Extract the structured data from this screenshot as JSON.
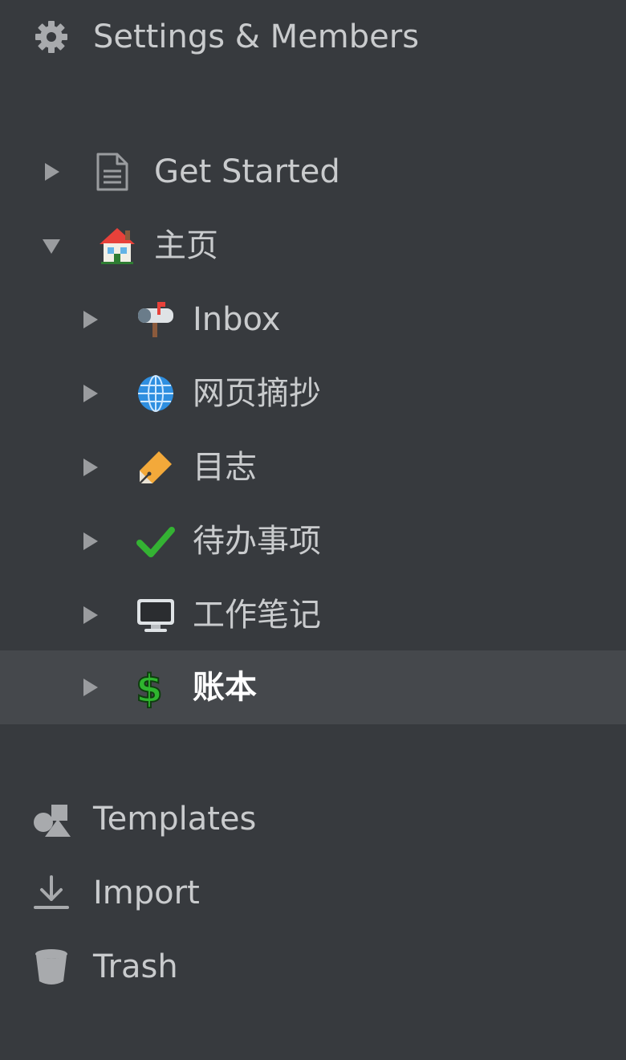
{
  "sidebar": {
    "top": {
      "settings": {
        "label": "Settings & Members",
        "icon": "gear-icon"
      }
    },
    "tree": [
      {
        "label": "Get Started",
        "icon": "document-icon",
        "expanded": false,
        "level": 0
      },
      {
        "label": "主页",
        "icon": "house-icon",
        "expanded": true,
        "level": 0
      },
      {
        "label": "Inbox",
        "icon": "mailbox-icon",
        "expanded": false,
        "level": 1
      },
      {
        "label": "网页摘抄",
        "icon": "globe-icon",
        "expanded": false,
        "level": 1
      },
      {
        "label": "目志",
        "icon": "pen-icon",
        "expanded": false,
        "level": 1
      },
      {
        "label": "待办事项",
        "icon": "checkmark-icon",
        "expanded": false,
        "level": 1
      },
      {
        "label": "工作笔记",
        "icon": "computer-icon",
        "expanded": false,
        "level": 1
      },
      {
        "label": "账本",
        "icon": "dollar-icon",
        "expanded": false,
        "level": 1,
        "selected": true
      }
    ],
    "bottom": {
      "templates": {
        "label": "Templates",
        "icon": "shapes-icon"
      },
      "import": {
        "label": "Import",
        "icon": "download-icon"
      },
      "trash": {
        "label": "Trash",
        "icon": "trash-icon"
      }
    }
  },
  "colors": {
    "background": "#373a3e",
    "selected_row": "#45484c",
    "text": "#c9cbcd",
    "icon_gray": "#a8aaad"
  }
}
